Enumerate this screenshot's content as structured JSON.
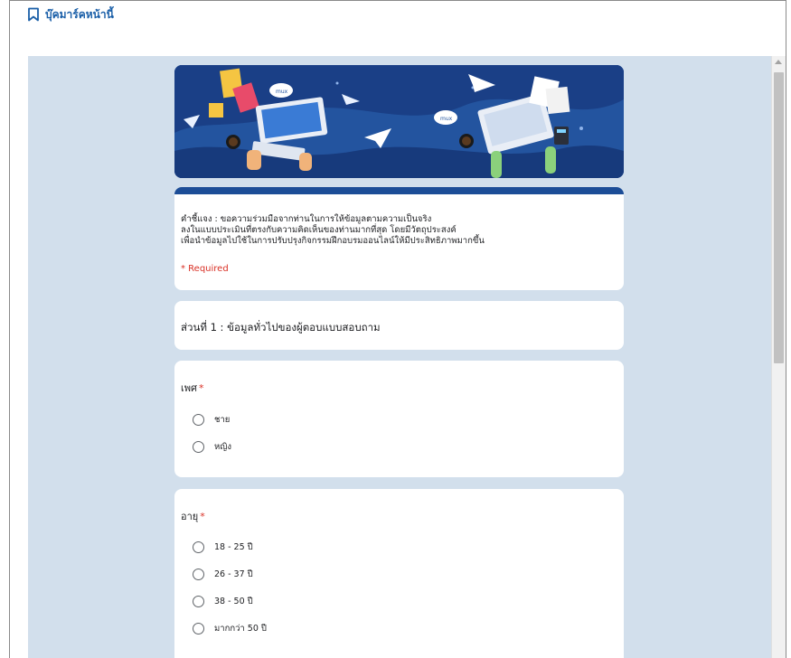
{
  "bookmark_bar": {
    "label": "บุ๊คมาร์คหน้านี้"
  },
  "form": {
    "banner": {
      "badge_left": "mux",
      "badge_right": "mux"
    },
    "intro": {
      "description_lines": [
        "คำชี้แจง : ขอความร่วมมือจากท่านในการให้ข้อมูลตามความเป็นจริง",
        "ลงในแบบประเมินที่ตรงกับความคิดเห็นของท่านมากที่สุด โดยมีวัตถุประสงค์",
        "เพื่อนำข้อมูลไปใช้ในการปรับปรุงกิจกรรมฝึกอบรมออนไลน์ให้มีประสิทธิภาพมากขึ้น"
      ],
      "required_note": "* Required"
    },
    "section": {
      "title": "ส่วนที่ 1 : ข้อมูลทั่วไปของผู้ตอบแบบสอบถาม"
    },
    "questions": [
      {
        "label": "เพศ",
        "required_mark": "*",
        "options": [
          "ชาย",
          "หญิง"
        ]
      },
      {
        "label": "อายุ",
        "required_mark": "*",
        "options": [
          "18 - 25 ปี",
          "26 - 37 ปี",
          "38 - 50 ปี",
          "มากกว่า 50 ปี"
        ]
      }
    ]
  },
  "colors": {
    "page_background": "#d2dfec",
    "header_accent": "#1c4d97",
    "required": "#d93025",
    "bookmark": "#1a5fa8"
  }
}
